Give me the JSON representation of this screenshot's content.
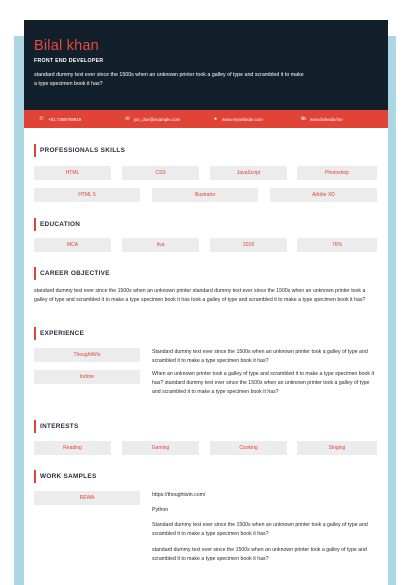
{
  "header": {
    "name": "Bilal khan",
    "role": "FRONT END DEVELOPER",
    "summary": "standard dummy text ever since the 1500s when an unknown printer took a galley of type and scrambled it to make a type specimen book it has?"
  },
  "contact": {
    "phone": "+91 7389788919",
    "email": "jon_doe@example.com",
    "website": "www.mywebsite.com",
    "linkedin": "www.linkedin/me"
  },
  "skills": {
    "title": "PROFESSIONALS SKILLS",
    "items": [
      "HTML",
      "CSS",
      "JavaScript",
      "Photoshop",
      "HTML 5",
      "Illustrator",
      "Adobe XD"
    ]
  },
  "education": {
    "title": "EDUCATION",
    "items": [
      "MCA",
      "Iiva",
      "2018",
      "76%"
    ]
  },
  "objective": {
    "title": "CAREER OBJECTIVE",
    "text": "standard dummy text ever since the 1500s when an unknown printer standard dummy text ever since the 1500s when an unknown printer took a galley of type and scrambled it to make a type specimen book it has took a galley of type and scrambled it to make a type specimen book it has?"
  },
  "experience": {
    "title": "EXPERIENCE",
    "items": [
      {
        "company": "ThoughtWin",
        "text": "Standard dummy text ever since the 1500s when an unknown printer took a galley of type and scrambled it to make a type specimen book it has?"
      },
      {
        "company": "Indore",
        "text": "When an unknown printer took a galley of type and scrambled it to make a type specimen book it has? standard dummy text ever since the 1500s when an unknown printer took a galley of type and scrambled it to make a type specimen book it has?"
      }
    ]
  },
  "interests": {
    "title": "INTERESTS",
    "items": [
      "Reading",
      "Gaming",
      "Cooking",
      "Singing"
    ]
  },
  "work": {
    "title": "WORK SAMPLES",
    "label": "REWA",
    "url": "https://thoughtwin.com/",
    "tech": "Python",
    "desc1": "Standard dummy text ever since the 1500s when an unknown printer took a galley of type and scrambled it to make a type specimen book it has?",
    "desc2": "standard dummy text ever since the 1500s when an unknown printer took a galley of type and scrambled it to make a type specimen book it has?"
  },
  "colors": {
    "accent": "#e14336",
    "header_bg": "#12202c",
    "frame": "#acd6e4",
    "chip_bg": "#ececec"
  }
}
